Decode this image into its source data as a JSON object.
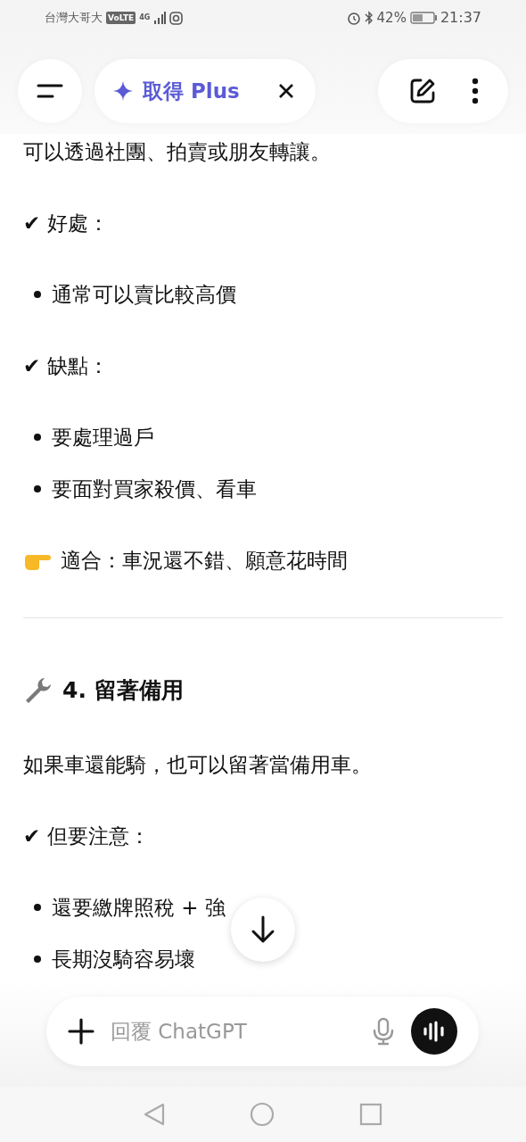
{
  "status_bar": {
    "carrier": "台灣大哥大",
    "network": "VoLTE",
    "signal_type": "4G",
    "battery": "42%",
    "time": "21:37"
  },
  "header": {
    "upgrade_label": "取得 Plus"
  },
  "content": [
    {
      "kind": "paragraph",
      "text": "可以透過社團、拍賣或朋友轉讓。"
    },
    {
      "kind": "check",
      "text": "✔ 好處："
    },
    {
      "kind": "bullet",
      "text": "通常可以賣比較高價"
    },
    {
      "kind": "check",
      "text": "✔ 缺點："
    },
    {
      "kind": "bullet",
      "text": "要處理過戶"
    },
    {
      "kind": "bullet",
      "text": "要面對買家殺價、看車"
    },
    {
      "kind": "pointer",
      "text": "適合：車況還不錯、願意花時間"
    },
    {
      "kind": "divider"
    },
    {
      "kind": "heading",
      "text": "4. 留著備用"
    },
    {
      "kind": "paragraph",
      "text": "如果車還能騎，也可以留著當備用車。"
    },
    {
      "kind": "check",
      "text": "✔ 但要注意："
    },
    {
      "kind": "bullet",
      "text": "還要繳牌照稅 + 強"
    },
    {
      "kind": "bullet",
      "text": "長期沒騎容易壞"
    }
  ],
  "composer": {
    "placeholder": "回覆 ChatGPT"
  }
}
